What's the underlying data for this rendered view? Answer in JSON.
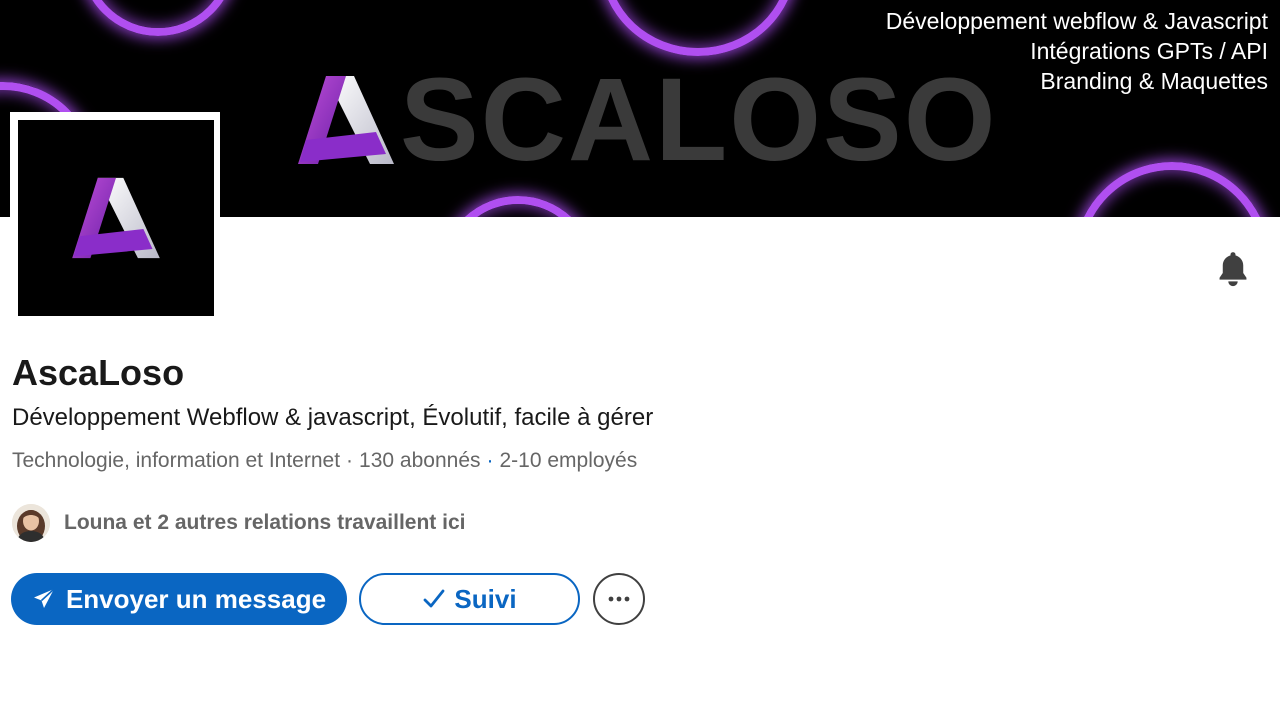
{
  "banner": {
    "wordmark": "SCALOSO",
    "tagline_lines": [
      "Développement webflow & Javascript",
      "Intégrations GPTs / API",
      "Branding & Maquettes"
    ]
  },
  "company": {
    "logo_icon": "ascaloso-a-logo",
    "name": "AscaLoso",
    "tagline": "Développement Webflow & javascript, Évolutif, facile à gérer",
    "industry": "Technologie, information et Internet",
    "followers": "130 abonnés",
    "employees": "2-10 employés"
  },
  "relations": {
    "text": "Louna et 2 autres relations travaillent ici"
  },
  "actions": {
    "message_label": "Envoyer un message",
    "message_icon": "send-icon",
    "follow_label": "Suivi",
    "follow_icon": "check-icon",
    "more_icon": "more-icon",
    "notification_icon": "bell-icon"
  },
  "colors": {
    "primary": "#0a66c2",
    "text": "#191919",
    "muted": "#666666",
    "neon": "#b04ff0"
  }
}
